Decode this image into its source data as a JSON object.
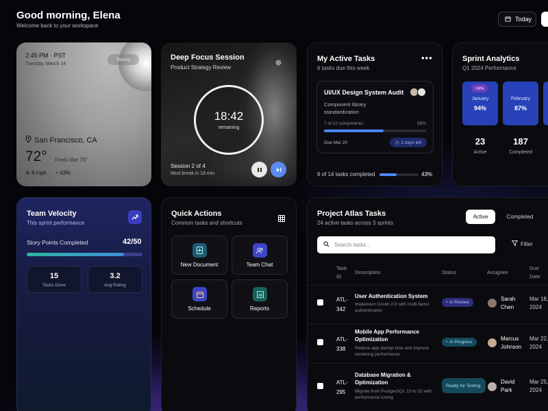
{
  "header": {
    "greeting": "Good morning, Elena",
    "subtitle": "Welcome back to your workspace",
    "today_label": "Today"
  },
  "weather": {
    "time": "2:45 PM · PST",
    "date": "Tuesday, March 14",
    "pill": "Sunny",
    "city": "San Francisco, CA",
    "temp": "72°",
    "feels": "Feels like 75°",
    "wind": "8 mph",
    "humidity": "43%"
  },
  "focus": {
    "title": "Deep Focus Session",
    "subtitle": "Product Strategy Review",
    "clock": "18:42",
    "remaining": "remaining",
    "session": "Session 2 of 4",
    "next": "Next break in 18 min"
  },
  "my_tasks": {
    "title": "My Active Tasks",
    "subtitle": "6 tasks due this week",
    "task_title": "UI/UX Design System Audit",
    "task_desc": "Component library standardization",
    "progress_label": "7 of 12 components",
    "progress_pct": "58%",
    "progress_value": 58,
    "due": "Due Mar 20",
    "days_left": "2 days left",
    "footer": "6 of 14 tasks completed",
    "footer_pct": "43%",
    "footer_value": 43
  },
  "analytics": {
    "title": "Sprint Analytics",
    "subtitle": "Q1 2024 Performance",
    "months": [
      {
        "name": "January",
        "value": "94%",
        "badge": "+8%"
      },
      {
        "name": "February",
        "value": "87%"
      }
    ],
    "stats": [
      {
        "value": "23",
        "label": "Active"
      },
      {
        "value": "187",
        "label": "Completed"
      }
    ]
  },
  "velocity": {
    "title": "Team Velocity",
    "subtitle": "This sprint performance",
    "points_label": "Story Points Completed",
    "points_value": "42/50",
    "points_fraction": 0.84,
    "boxes": [
      {
        "value": "15",
        "label": "Tasks Done"
      },
      {
        "value": "3.2",
        "label": "Avg Rating"
      }
    ]
  },
  "quick": {
    "title": "Quick Actions",
    "subtitle": "Common tasks and shortcuts",
    "actions": [
      {
        "label": "New Document",
        "icon": "document-icon",
        "color": "#1e5a73"
      },
      {
        "label": "Team Chat",
        "icon": "users-icon",
        "color": "#3e46c9"
      },
      {
        "label": "Schedule",
        "icon": "calendar-icon",
        "color": "#3e46c9"
      },
      {
        "label": "Reports",
        "icon": "chart-icon",
        "color": "#17615a"
      }
    ]
  },
  "project": {
    "title": "Project Atlas Tasks",
    "subtitle": "24 active tasks across 3 sprints",
    "tab_active": "Active",
    "tab_completed": "Completed",
    "search_placeholder": "Search tasks...",
    "filter": "Filter",
    "columns": [
      "Task ID",
      "Description",
      "Status",
      "Assignee",
      "Due Date"
    ],
    "rows": [
      {
        "id": "ATL-342",
        "title": "User Authentication System",
        "desc": "Implement OAuth 2.0 with multi-factor authentication",
        "status": "In Review",
        "status_color": "#2c2f7a",
        "status_text": "#b8bcff",
        "assignee": "Sarah Chen",
        "due": "Mar 18, 2024"
      },
      {
        "id": "ATL-338",
        "title": "Mobile App Performance Optimization",
        "desc": "Reduce app startup time and improve rendering performance",
        "status": "In Progress",
        "status_color": "#154a5a",
        "status_text": "#9fe3f2",
        "assignee": "Marcus Johnson",
        "due": "Mar 22, 2024"
      },
      {
        "id": "ATL-295",
        "title": "Database Migration & Optimization",
        "desc": "Migrate from PostgreSQL 13 to 15 with performance tuning",
        "status": "Ready for Testing",
        "status_color": "#154a5a",
        "status_text": "#9fe3f2",
        "assignee": "David Park",
        "due": "Mar 25, 2024"
      }
    ]
  }
}
